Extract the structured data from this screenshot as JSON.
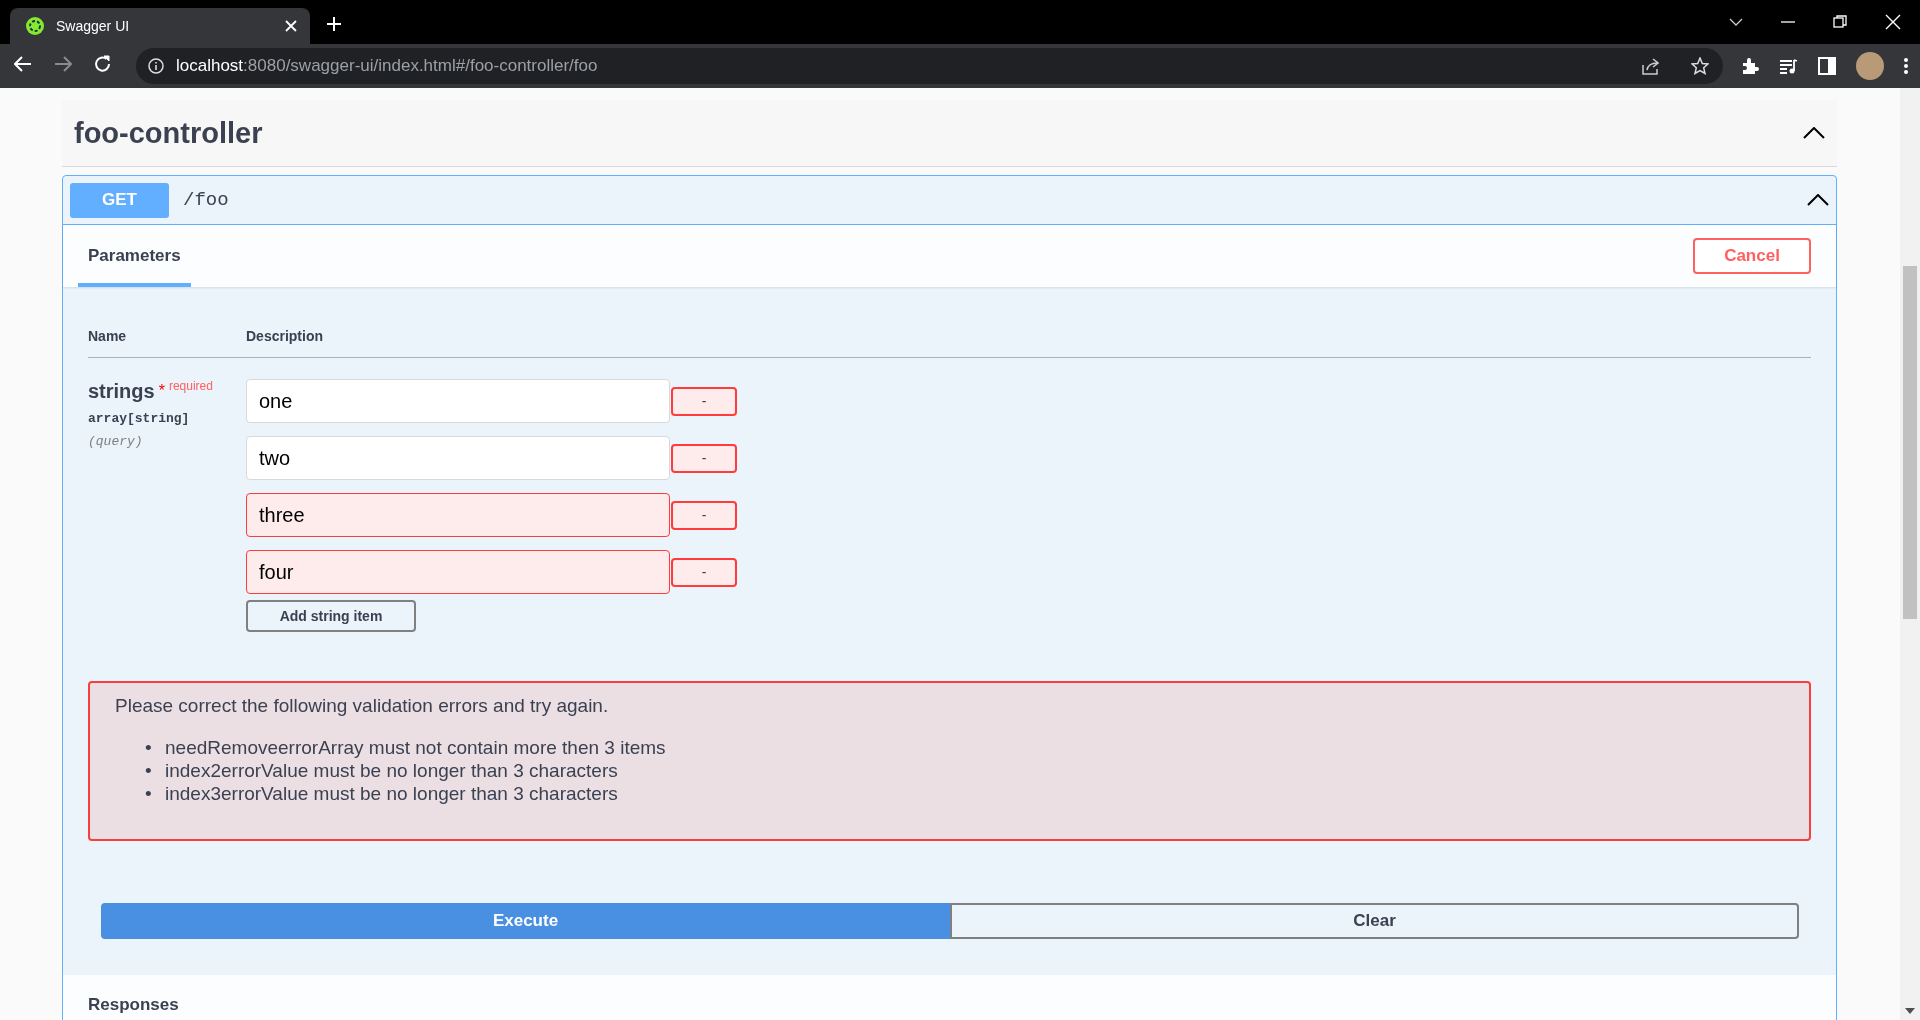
{
  "browser": {
    "tab_title": "Swagger UI",
    "url_host": "localhost",
    "url_rest": ":8080/swagger-ui/index.html#/foo-controller/foo"
  },
  "tag": {
    "name": "foo-controller",
    "expanded": true
  },
  "operation": {
    "method": "GET",
    "path": "/foo",
    "expanded": true,
    "tabs": [
      {
        "label": "Parameters",
        "selected": true
      }
    ],
    "cancel": "Cancel",
    "columns": [
      "Name",
      "Description"
    ],
    "parameters": [
      {
        "name": "strings",
        "required_mark": "*",
        "required_label": "required",
        "type": "array[string]",
        "location": "(query)",
        "items": [
          {
            "value": "one",
            "invalid": false,
            "remove": "-"
          },
          {
            "value": "two",
            "invalid": false,
            "remove": "-"
          },
          {
            "value": "three",
            "invalid": true,
            "remove": "-"
          },
          {
            "value": "four",
            "invalid": true,
            "remove": "-"
          }
        ],
        "add_button": "Add string item"
      }
    ],
    "validation": {
      "message": "Please correct the following validation errors and try again.",
      "errors": [
        {
          "bullet": "•",
          "text": "needRemoveerrorArray must not contain more then 3 items"
        },
        {
          "bullet": "•",
          "text": "index2errorValue must be no longer than 3 characters"
        },
        {
          "bullet": "•",
          "text": "index3errorValue must be no longer than 3 characters"
        }
      ]
    },
    "buttons": [
      {
        "label": "Execute",
        "kind": "primary"
      },
      {
        "label": "Clear",
        "kind": "secondary"
      }
    ],
    "responses_title": "Responses"
  }
}
